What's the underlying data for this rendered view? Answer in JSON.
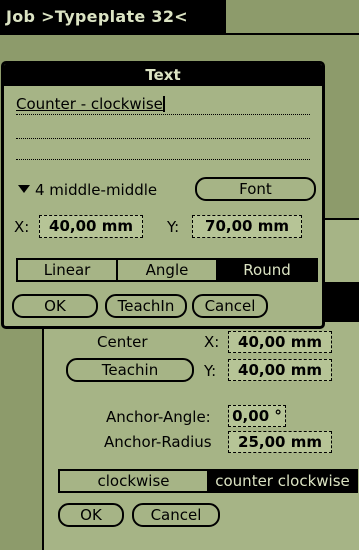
{
  "topbar": {
    "title": "Job >Typeplate 32<"
  },
  "round_dialog": {
    "center_label": "Center",
    "teachin_button": "Teachin",
    "x_label": "X:",
    "y_label": "Y:",
    "x_value": "40,00 mm",
    "y_value": "40,00 mm",
    "anchor_angle_label": "Anchor-Angle:",
    "anchor_angle_value": "0,00 °",
    "anchor_radius_label": "Anchor-Radius",
    "anchor_radius_value": "25,00 mm",
    "direction_options": [
      "clockwise",
      "counter clockwise"
    ],
    "direction_selected": "counter clockwise",
    "ok_button": "OK",
    "cancel_button": "Cancel"
  },
  "text_dialog": {
    "title": "Text",
    "text_value": "Counter - clockwise",
    "alignment": "4 middle-middle",
    "font_button": "Font",
    "x_label": "X:",
    "x_value": "40,00 mm",
    "y_label": "Y:",
    "y_value": "70,00 mm",
    "modes": [
      "Linear",
      "Angle",
      "Round"
    ],
    "mode_selected": "Round",
    "ok_button": "OK",
    "teachin_button": "TeachIn",
    "cancel_button": "Cancel"
  },
  "colors": {
    "screen": "#8d9b6b",
    "panel": "#a6b486",
    "ink": "#000000",
    "inverse_text": "#dbe3c3"
  }
}
